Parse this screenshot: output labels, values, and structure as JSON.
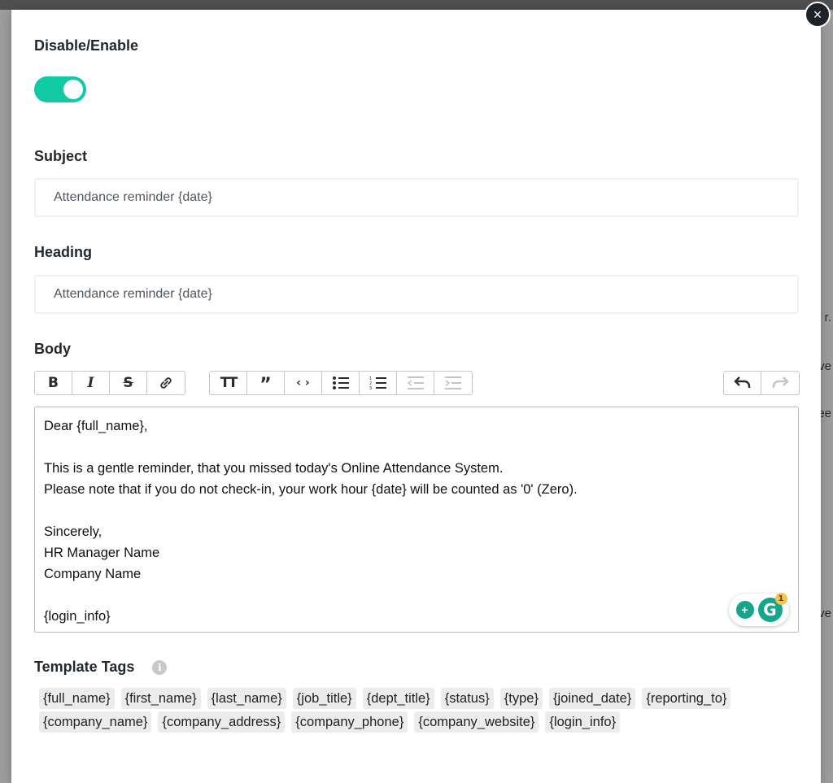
{
  "background": {
    "fragments": [
      "r.",
      "ve",
      "ee",
      "ve"
    ]
  },
  "modal": {
    "close_label": "×",
    "toggle": {
      "label": "Disable/Enable",
      "enabled": true
    },
    "subject": {
      "label": "Subject",
      "value": "Attendance reminder {date}"
    },
    "heading": {
      "label": "Heading",
      "value": "Attendance reminder {date}"
    },
    "body": {
      "label": "Body",
      "toolbar": {
        "bold": "bold-icon",
        "italic": "italic-icon",
        "strike": "strikethrough-icon",
        "link": "link-icon",
        "heading": "heading-icon",
        "quote": "quote-icon",
        "code": "code-icon",
        "bullets": "bullet-list-icon",
        "numbers": "numbered-list-icon",
        "outdent": "outdent-icon",
        "indent": "indent-icon",
        "undo": "undo-icon",
        "redo": "redo-icon"
      },
      "lines": [
        "Dear {full_name},",
        "",
        "This is a gentle reminder, that you missed today's Online Attendance System.",
        "Please note that if you do not check-in, your work hour {date} will be counted as '0' (Zero).",
        "",
        "Sincerely,",
        "HR Manager Name",
        "Company Name",
        "",
        "{login_info}"
      ],
      "grammarly_badge": "1"
    },
    "template_tags": {
      "label": "Template Tags",
      "info_icon": "i",
      "tags": [
        "{full_name}",
        "{first_name}",
        "{last_name}",
        "{job_title}",
        "{dept_title}",
        "{status}",
        "{type}",
        "{joined_date}",
        "{reporting_to}",
        "{company_name}",
        "{company_address}",
        "{company_phone}",
        "{company_website}",
        "{login_info}"
      ]
    }
  },
  "colors": {
    "toggle_on": "#10c9a5",
    "grammarly": "#15a58a"
  }
}
